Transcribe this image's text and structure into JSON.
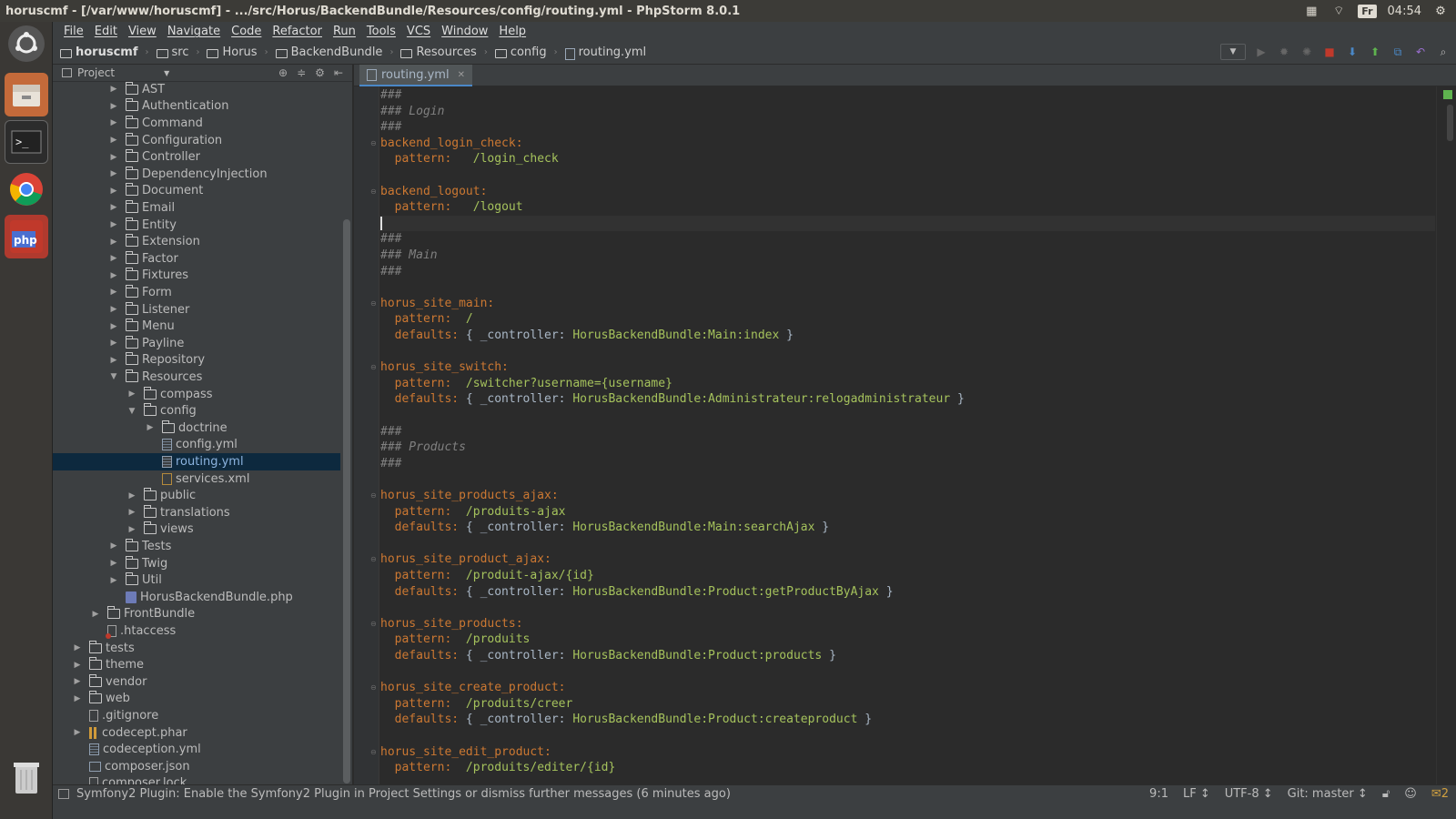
{
  "window": {
    "title": "horuscmf - [/var/www/horuscmf] - .../src/Horus/BackendBundle/Resources/config/routing.yml - PhpStorm 8.0.1",
    "keyboard_layout": "Fr",
    "clock": "04:54"
  },
  "menu": [
    "File",
    "Edit",
    "View",
    "Navigate",
    "Code",
    "Refactor",
    "Run",
    "Tools",
    "VCS",
    "Window",
    "Help"
  ],
  "breadcrumbs": [
    "horuscmf",
    "src",
    "Horus",
    "BackendBundle",
    "Resources",
    "config",
    "routing.yml"
  ],
  "project_panel": {
    "title": "Project",
    "tree": [
      {
        "label": "AST",
        "type": "folder",
        "depth": 2,
        "expanded": false
      },
      {
        "label": "Authentication",
        "type": "folder",
        "depth": 2,
        "expanded": false
      },
      {
        "label": "Command",
        "type": "folder",
        "depth": 2,
        "expanded": false
      },
      {
        "label": "Configuration",
        "type": "folder",
        "depth": 2,
        "expanded": false
      },
      {
        "label": "Controller",
        "type": "folder",
        "depth": 2,
        "expanded": false
      },
      {
        "label": "DependencyInjection",
        "type": "folder",
        "depth": 2,
        "expanded": false
      },
      {
        "label": "Document",
        "type": "folder",
        "depth": 2,
        "expanded": false
      },
      {
        "label": "Email",
        "type": "folder",
        "depth": 2,
        "expanded": false
      },
      {
        "label": "Entity",
        "type": "folder",
        "depth": 2,
        "expanded": false
      },
      {
        "label": "Extension",
        "type": "folder",
        "depth": 2,
        "expanded": false
      },
      {
        "label": "Factor",
        "type": "folder",
        "depth": 2,
        "expanded": false
      },
      {
        "label": "Fixtures",
        "type": "folder",
        "depth": 2,
        "expanded": false
      },
      {
        "label": "Form",
        "type": "folder",
        "depth": 2,
        "expanded": false
      },
      {
        "label": "Listener",
        "type": "folder",
        "depth": 2,
        "expanded": false
      },
      {
        "label": "Menu",
        "type": "folder",
        "depth": 2,
        "expanded": false
      },
      {
        "label": "Payline",
        "type": "folder",
        "depth": 2,
        "expanded": false
      },
      {
        "label": "Repository",
        "type": "folder",
        "depth": 2,
        "expanded": false
      },
      {
        "label": "Resources",
        "type": "folder",
        "depth": 2,
        "expanded": true
      },
      {
        "label": "compass",
        "type": "folder",
        "depth": 3,
        "expanded": false
      },
      {
        "label": "config",
        "type": "folder",
        "depth": 3,
        "expanded": true
      },
      {
        "label": "doctrine",
        "type": "folder",
        "depth": 4,
        "expanded": false
      },
      {
        "label": "config.yml",
        "type": "yml",
        "depth": 4
      },
      {
        "label": "routing.yml",
        "type": "yml",
        "depth": 4,
        "selected": true
      },
      {
        "label": "services.xml",
        "type": "xml",
        "depth": 4
      },
      {
        "label": "public",
        "type": "folder",
        "depth": 3,
        "expanded": false
      },
      {
        "label": "translations",
        "type": "folder",
        "depth": 3,
        "expanded": false
      },
      {
        "label": "views",
        "type": "folder",
        "depth": 3,
        "expanded": false
      },
      {
        "label": "Tests",
        "type": "folder",
        "depth": 2,
        "expanded": false
      },
      {
        "label": "Twig",
        "type": "folder",
        "depth": 2,
        "expanded": false
      },
      {
        "label": "Util",
        "type": "folder",
        "depth": 2,
        "expanded": false
      },
      {
        "label": "HorusBackendBundle.php",
        "type": "php",
        "depth": 2
      },
      {
        "label": "FrontBundle",
        "type": "folder",
        "depth": 1,
        "expanded": false
      },
      {
        "label": ".htaccess",
        "type": "ht",
        "depth": 1
      },
      {
        "label": "tests",
        "type": "folder",
        "depth": 0,
        "expanded": false
      },
      {
        "label": "theme",
        "type": "folder",
        "depth": 0,
        "expanded": false
      },
      {
        "label": "vendor",
        "type": "folder",
        "depth": 0,
        "expanded": false
      },
      {
        "label": "web",
        "type": "folder",
        "depth": 0,
        "expanded": false
      },
      {
        "label": ".gitignore",
        "type": "txt",
        "depth": 0
      },
      {
        "label": "codecept.phar",
        "type": "phar",
        "depth": 0,
        "expanded": false
      },
      {
        "label": "codeception.yml",
        "type": "yml",
        "depth": 0
      },
      {
        "label": "composer.json",
        "type": "json",
        "depth": 0
      },
      {
        "label": "composer.lock",
        "type": "txt",
        "depth": 0
      }
    ]
  },
  "editor": {
    "tab": "routing.yml",
    "lines": [
      {
        "kind": "comment",
        "text": "###"
      },
      {
        "kind": "comment",
        "text": "### Login"
      },
      {
        "kind": "comment",
        "text": "###"
      },
      {
        "kind": "key",
        "key": "backend_login_check:"
      },
      {
        "kind": "prop",
        "prop": "  pattern:",
        "value": "   /login_check"
      },
      {
        "kind": "blank"
      },
      {
        "kind": "key",
        "key": "backend_logout:"
      },
      {
        "kind": "prop",
        "prop": "  pattern:",
        "value": "   /logout"
      },
      {
        "kind": "caret"
      },
      {
        "kind": "comment",
        "text": "###"
      },
      {
        "kind": "comment",
        "text": "### Main"
      },
      {
        "kind": "comment",
        "text": "###"
      },
      {
        "kind": "blank"
      },
      {
        "kind": "key",
        "key": "horus_site_main:"
      },
      {
        "kind": "prop",
        "prop": "  pattern:",
        "value": "  /"
      },
      {
        "kind": "defaults",
        "prop": "  defaults:",
        "pre": " { _controller: ",
        "value": "HorusBackendBundle:Main:index",
        "post": " }"
      },
      {
        "kind": "blank"
      },
      {
        "kind": "key",
        "key": "horus_site_switch:"
      },
      {
        "kind": "prop",
        "prop": "  pattern:",
        "value": "  /switcher?username={username}"
      },
      {
        "kind": "defaults",
        "prop": "  defaults:",
        "pre": " { _controller: ",
        "value": "HorusBackendBundle:Administrateur:relogadministrateur",
        "post": " }"
      },
      {
        "kind": "blank"
      },
      {
        "kind": "comment",
        "text": "###"
      },
      {
        "kind": "comment",
        "text": "### Products"
      },
      {
        "kind": "comment",
        "text": "###"
      },
      {
        "kind": "blank"
      },
      {
        "kind": "key",
        "key": "horus_site_products_ajax:"
      },
      {
        "kind": "prop",
        "prop": "  pattern:",
        "value": "  /produits-ajax"
      },
      {
        "kind": "defaults",
        "prop": "  defaults:",
        "pre": " { _controller: ",
        "value": "HorusBackendBundle:Main:searchAjax",
        "post": " }"
      },
      {
        "kind": "blank"
      },
      {
        "kind": "key",
        "key": "horus_site_product_ajax:"
      },
      {
        "kind": "prop",
        "prop": "  pattern:",
        "value": "  /produit-ajax/{id}"
      },
      {
        "kind": "defaults",
        "prop": "  defaults:",
        "pre": " { _controller: ",
        "value": "HorusBackendBundle:Product:getProductByAjax",
        "post": " }"
      },
      {
        "kind": "blank"
      },
      {
        "kind": "key",
        "key": "horus_site_products:"
      },
      {
        "kind": "prop",
        "prop": "  pattern:",
        "value": "  /produits"
      },
      {
        "kind": "defaults",
        "prop": "  defaults:",
        "pre": " { _controller: ",
        "value": "HorusBackendBundle:Product:products",
        "post": " }"
      },
      {
        "kind": "blank"
      },
      {
        "kind": "key",
        "key": "horus_site_create_product:"
      },
      {
        "kind": "prop",
        "prop": "  pattern:",
        "value": "  /produits/creer"
      },
      {
        "kind": "defaults",
        "prop": "  defaults:",
        "pre": " { _controller: ",
        "value": "HorusBackendBundle:Product:createproduct",
        "post": " }"
      },
      {
        "kind": "blank"
      },
      {
        "kind": "key",
        "key": "horus_site_edit_product:"
      },
      {
        "kind": "prop",
        "prop": "  pattern:",
        "value": "  /produits/editer/{id}"
      }
    ]
  },
  "status": {
    "message": "Symfony2 Plugin: Enable the Symfony2 Plugin in Project Settings or dismiss further messages (6 minutes ago)",
    "position": "9:1",
    "line_ending": "LF ↕",
    "encoding": "UTF-8 ↕",
    "vcs": "Git: master ↕",
    "notifications": "2"
  },
  "colors": {
    "accent": "#4a88c7",
    "selection": "#0d293e",
    "comment": "#808080",
    "keyword": "#cc7832",
    "string": "#a5c25c"
  }
}
